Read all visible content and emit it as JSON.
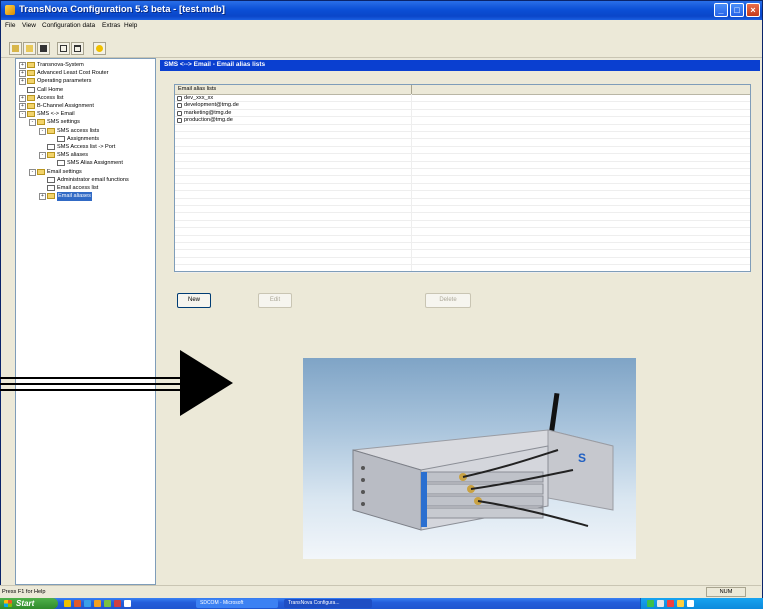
{
  "window": {
    "title": "TransNova Configuration 5.3 beta - [test.mdb]"
  },
  "menu": [
    "File",
    "View",
    "Configuration data",
    "Extras",
    "Help"
  ],
  "toolbar": {
    "buttons": [
      "open-icon",
      "open-folder-icon",
      "save-icon",
      "split-view-icon",
      "window-icon",
      "help-icon"
    ]
  },
  "tree": {
    "items": [
      {
        "label": "Transnova-System",
        "indent": 0,
        "expander": "+",
        "icon": "folder"
      },
      {
        "label": "Advanced Least Cost Router",
        "indent": 0,
        "expander": "+",
        "icon": "folder"
      },
      {
        "label": "Operating parameters",
        "indent": 0,
        "expander": "+",
        "icon": "folder"
      },
      {
        "label": "Call Home",
        "indent": 0,
        "expander": "",
        "icon": "doc"
      },
      {
        "label": "Access list",
        "indent": 0,
        "expander": "+",
        "icon": "folder"
      },
      {
        "label": "B-Channel Assignment",
        "indent": 0,
        "expander": "+",
        "icon": "folder"
      },
      {
        "label": "SMS <-> Email",
        "indent": 0,
        "expander": "-",
        "icon": "folder"
      },
      {
        "label": "SMS settings",
        "indent": 1,
        "expander": "-",
        "icon": "folder"
      },
      {
        "label": "SMS access lists",
        "indent": 2,
        "expander": "-",
        "icon": "folder"
      },
      {
        "label": "Assignments",
        "indent": 3,
        "expander": "",
        "icon": "doc"
      },
      {
        "label": "SMS Access list -> Port",
        "indent": 2,
        "expander": "",
        "icon": "doc"
      },
      {
        "label": "SMS aliases",
        "indent": 2,
        "expander": "-",
        "icon": "folder"
      },
      {
        "label": "SMS Alias Assignment",
        "indent": 3,
        "expander": "",
        "icon": "doc"
      },
      {
        "label": "Email settings",
        "indent": 1,
        "expander": "-",
        "icon": "folder"
      },
      {
        "label": "Administrator email functions",
        "indent": 2,
        "expander": "",
        "icon": "doc"
      },
      {
        "label": "Email access list",
        "indent": 2,
        "expander": "",
        "icon": "doc"
      },
      {
        "label": "Email aliases",
        "indent": 2,
        "expander": "+",
        "icon": "folder",
        "selected": true
      }
    ]
  },
  "panel": {
    "header": "SMS <--> Email - Email alias lists",
    "column": "Email alias lists",
    "rows": [
      "dev_xxx_xx",
      "development@tmg.de",
      "marketing@tmg.de",
      "production@tmg.de"
    ],
    "buttons": {
      "new": "New",
      "edit": "Edit",
      "delete": "Delete"
    }
  },
  "status": {
    "text": "Press F1 for Help",
    "num": "NUM"
  },
  "taskbar": {
    "start": "Start",
    "tasks": [
      "SDCOM - Microsoft",
      "TransNova Configura..."
    ]
  },
  "colors": {
    "slide_background": "#ffff99",
    "selection": "#316ac5",
    "title_bar": "#0b4fd6",
    "panel_header": "#0a3fd0"
  }
}
